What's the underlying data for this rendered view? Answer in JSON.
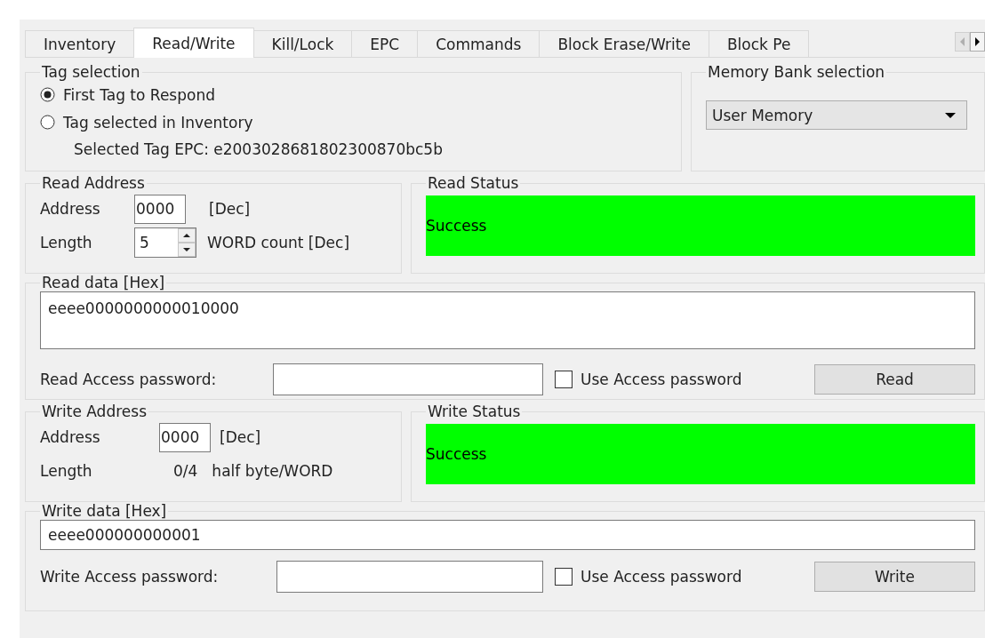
{
  "tabs": [
    {
      "label": "Inventory",
      "selected": false
    },
    {
      "label": "Read/Write",
      "selected": true
    },
    {
      "label": "Kill/Lock",
      "selected": false
    },
    {
      "label": "EPC",
      "selected": false
    },
    {
      "label": "Commands",
      "selected": false
    },
    {
      "label": "Block Erase/Write",
      "selected": false
    },
    {
      "label": "Block Pe",
      "selected": false
    }
  ],
  "tag_selection": {
    "title": "Tag selection",
    "options": [
      {
        "label": "First Tag to Respond",
        "selected": true
      },
      {
        "label": "Tag selected in Inventory",
        "selected": false
      }
    ],
    "selected_tag_epc": "Selected Tag EPC: e2003028681802300870bc5b"
  },
  "memory_bank": {
    "title": "Memory Bank selection",
    "value": "User Memory"
  },
  "read_address": {
    "title": "Read Address",
    "address_label": "Address",
    "address_value": "0000",
    "address_unit": "[Dec]",
    "length_label": "Length",
    "length_value": "5",
    "length_unit": "WORD count [Dec]"
  },
  "read_status": {
    "title": "Read Status",
    "text": "Success",
    "kind": "success"
  },
  "read_data": {
    "title": "Read data [Hex]",
    "value": "eeee0000000000010000",
    "password_label": "Read Access password:",
    "use_password": {
      "label": "Use Access password",
      "checked": false
    },
    "button": "Read"
  },
  "write_address": {
    "title": "Write Address",
    "address_label": "Address",
    "address_value": "0000",
    "address_unit": "[Dec]",
    "length_label": "Length",
    "length_value": "0/4",
    "length_unit": "half byte/WORD"
  },
  "write_status": {
    "title": "Write Status",
    "text": "Success",
    "kind": "success"
  },
  "write_data": {
    "title": "Write data [Hex]",
    "value": "eeee000000000001",
    "password_label": "Write Access password:",
    "use_password": {
      "label": "Use Access password",
      "checked": false
    },
    "button": "Write"
  }
}
